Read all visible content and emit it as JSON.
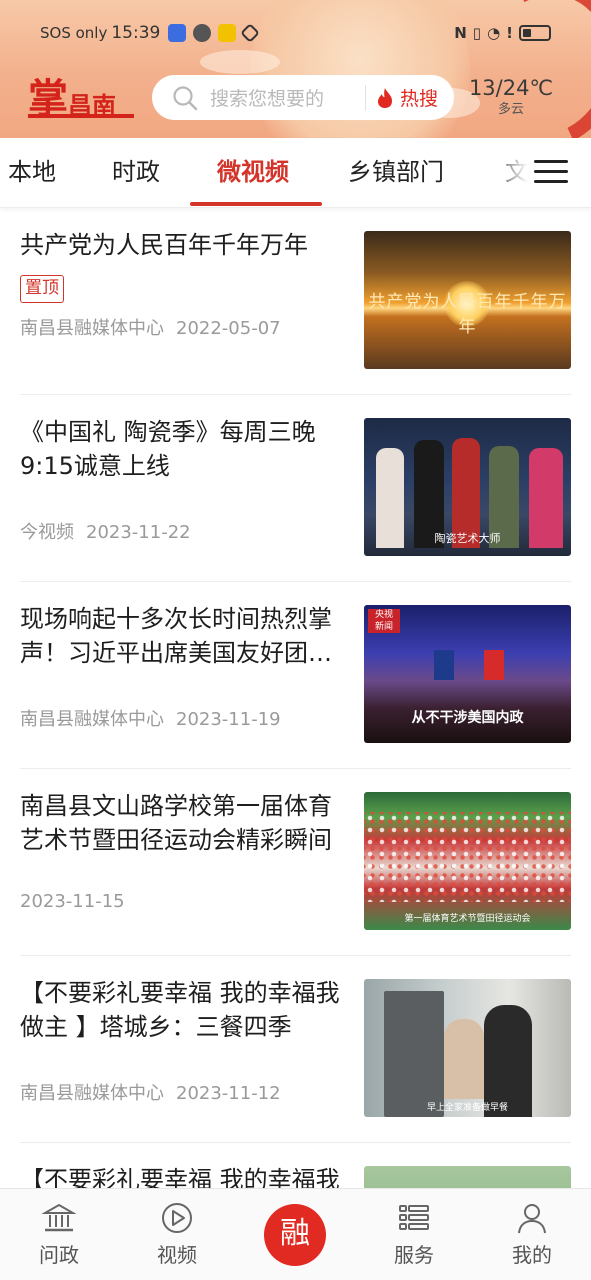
{
  "status_bar": {
    "carrier": "SOS only",
    "time": "15:39"
  },
  "header": {
    "logo_main": "掌",
    "logo_sub": "昌南",
    "search_placeholder": "搜索您想要的",
    "hot_search_label": "热搜",
    "weather_temp": "13/24℃",
    "weather_condition": "多云"
  },
  "tabs": [
    {
      "label": "本地",
      "active": false
    },
    {
      "label": "时政",
      "active": false
    },
    {
      "label": "微视频",
      "active": true
    },
    {
      "label": "乡镇部门",
      "active": false
    },
    {
      "label": "文",
      "active": false
    }
  ],
  "feed": [
    {
      "title": "共产党为人民百年千年万年",
      "pinned_label": "置顶",
      "source": "南昌县融媒体中心",
      "date": "2022-05-07",
      "thumb_caption": "共产党为人民百年千年万年"
    },
    {
      "title": "《中国礼 陶瓷季》每周三晚9:15诚意上线",
      "source": "今视频",
      "date": "2023-11-22",
      "thumb_caption": "陶瓷艺术大师"
    },
    {
      "title": "现场响起十多次长时间热烈掌声！习近平出席美国友好团体联合欢迎宴会并发表演讲",
      "source": "南昌县融媒体中心",
      "date": "2023-11-19",
      "thumb_caption": "从不干涉美国内政"
    },
    {
      "title": "南昌县文山路学校第一届体育艺术节暨田径运动会精彩瞬间",
      "source": "",
      "date": "2023-11-15",
      "thumb_caption": "第一届体育艺术节暨田径运动会"
    },
    {
      "title": "【不要彩礼要幸福 我的幸福我做主 】塔城乡：三餐四季",
      "source": "南昌县融媒体中心",
      "date": "2023-11-12",
      "thumb_caption": "早上全家准备做早餐"
    },
    {
      "title": "【不要彩礼要幸福 我的幸福我做主 】",
      "source": "",
      "date": "",
      "thumb_caption": ""
    }
  ],
  "bottom_nav": [
    {
      "label": "问政",
      "icon": "building-icon"
    },
    {
      "label": "视频",
      "icon": "play-icon"
    },
    {
      "label": "融",
      "icon": "center-logo"
    },
    {
      "label": "服务",
      "icon": "list-icon"
    },
    {
      "label": "我的",
      "icon": "user-icon"
    }
  ],
  "colors": {
    "accent": "#d3352b",
    "header_bg": "#f3b08c",
    "meta_text": "#9a9a9a"
  }
}
